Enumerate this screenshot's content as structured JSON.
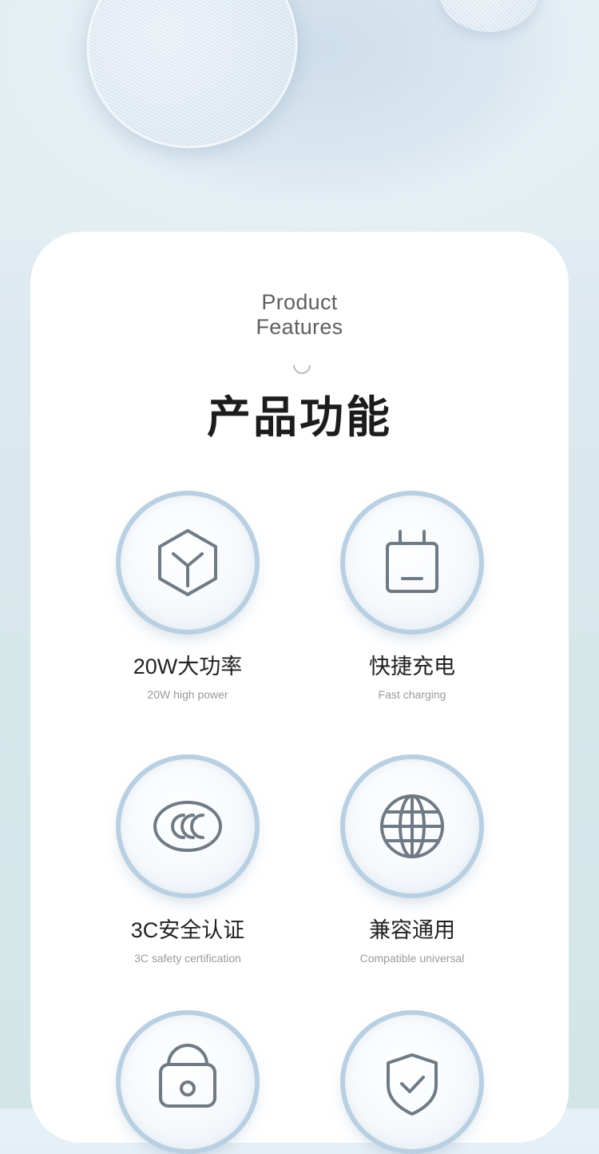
{
  "section": {
    "title_en_line1": "Product",
    "title_en_line2": "Features",
    "title_cn": "产品功能"
  },
  "features": [
    {
      "title_cn": "20W大功率",
      "title_en": "20W high power",
      "icon": "cube-icon"
    },
    {
      "title_cn": "快捷充电",
      "title_en": "Fast charging",
      "icon": "charger-plug-icon"
    },
    {
      "title_cn": "3C安全认证",
      "title_en": "3C safety certification",
      "icon": "ccc-certification-icon"
    },
    {
      "title_cn": "兼容通用",
      "title_en": "Compatible universal",
      "icon": "globe-icon"
    },
    {
      "title_cn": "",
      "title_en": "",
      "icon": "lock-icon"
    },
    {
      "title_cn": "",
      "title_en": "",
      "icon": "shield-check-icon"
    }
  ],
  "colors": {
    "icon_stroke": "#6f7a85",
    "ring": "#b9cfe2",
    "card": "#ffffff"
  }
}
